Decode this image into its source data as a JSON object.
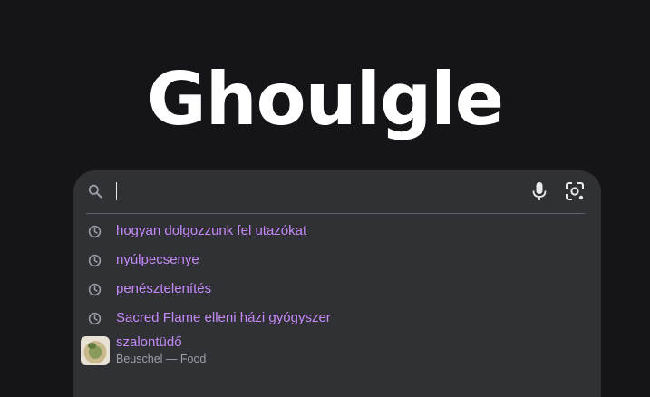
{
  "logo": {
    "text": "Ghoulgle"
  },
  "search": {
    "value": "",
    "icons": {
      "search": "search-icon",
      "voice": "microphone-icon",
      "lens": "camera-lens-icon"
    }
  },
  "suggestions": [
    {
      "text": "hogyan dolgozzunk fel utazókat",
      "icon": "history-clock-icon"
    },
    {
      "text": "nyúlpecsenye",
      "icon": "history-clock-icon"
    },
    {
      "text": "penésztelenítés",
      "icon": "history-clock-icon"
    },
    {
      "text": "Sacred Flame elleni házi gyógyszer",
      "icon": "history-clock-icon"
    }
  ],
  "rich_suggestion": {
    "title": "szalontüdő",
    "subtitle": "Beuschel — Food",
    "thumbnail": "food-thumbnail-image"
  },
  "colors": {
    "background": "#141419",
    "panel": "#303134",
    "suggestion_text": "#c58af9",
    "muted_text": "#9aa0a6",
    "icon": "#9aa0a6"
  }
}
